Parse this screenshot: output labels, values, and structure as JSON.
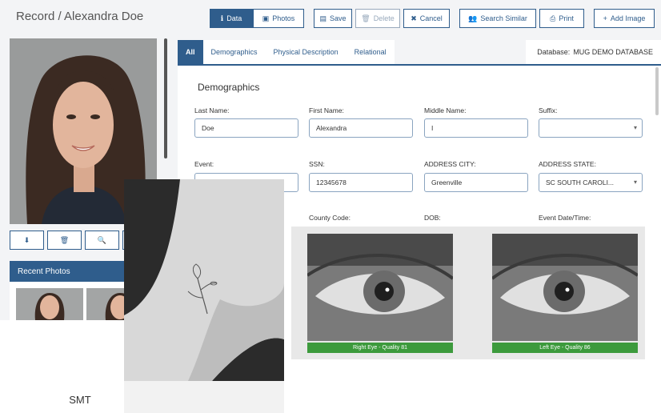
{
  "header": {
    "title": "Record / Alexandra Doe"
  },
  "toolbar": {
    "data": "Data",
    "photos": "Photos",
    "save": "Save",
    "delete": "Delete",
    "cancel": "Cancel",
    "search_similar": "Search Similar",
    "print": "Print",
    "add_image": "Add Image"
  },
  "sidebar": {
    "recent_photos": "Recent Photos"
  },
  "tabs": [
    "All",
    "Demographics",
    "Physical Description",
    "Relational"
  ],
  "database": {
    "label": "Database:",
    "value": "MUG DEMO DATABASE"
  },
  "form": {
    "section_title": "Demographics",
    "fields": {
      "last_name": {
        "label": "Last Name:",
        "value": "Doe"
      },
      "first_name": {
        "label": "First Name:",
        "value": "Alexandra"
      },
      "middle_name": {
        "label": "Middle Name:",
        "value": "I"
      },
      "suffix": {
        "label": "Suffix:",
        "value": ""
      },
      "event": {
        "label": "Event:",
        "value": ""
      },
      "ssn": {
        "label": "SSN:",
        "value": "12345678"
      },
      "address_city": {
        "label": "ADDRESS CITY:",
        "value": "Greenville"
      },
      "address_state": {
        "label": "ADDRESS STATE:",
        "value": "SC SOUTH CAROLI..."
      },
      "county_code": {
        "label": "County Code:"
      },
      "dob": {
        "label": "DOB:"
      },
      "event_datetime": {
        "label": "Event Date/Time:"
      }
    }
  },
  "smt": {
    "caption": "SMT"
  },
  "iris": {
    "right_label": "Right Eye - Quality 81",
    "left_label": "Left Eye - Quality 86"
  },
  "colors": {
    "primary": "#2f5d8c",
    "quality_bar": "#3c9a3c"
  }
}
